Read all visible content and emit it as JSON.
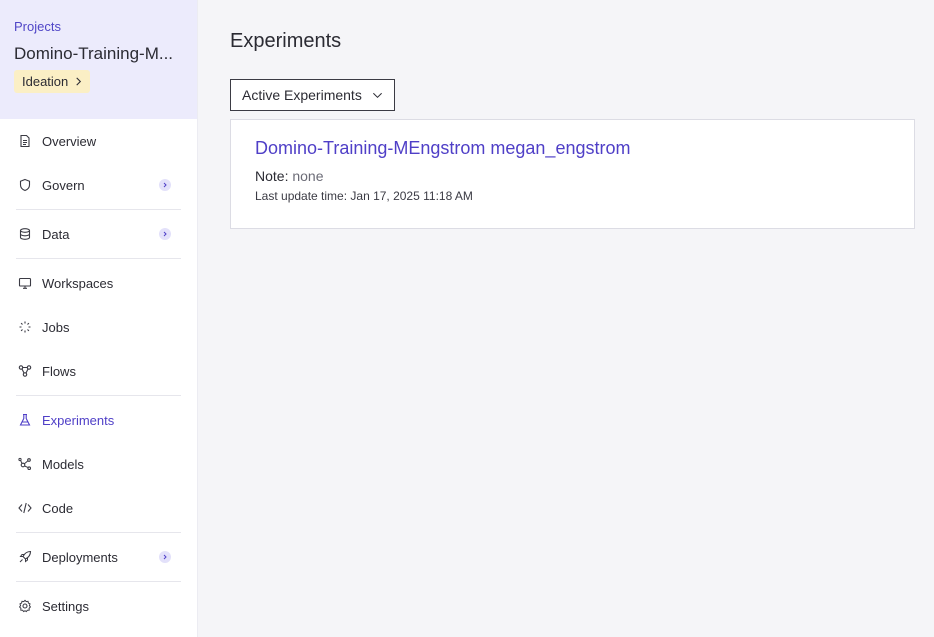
{
  "sidebar": {
    "projects_link": "Projects",
    "project_name": "Domino-Training-M...",
    "stage_label": "Ideation",
    "items": [
      {
        "label": "Overview",
        "icon": "document-icon",
        "expandable": false
      },
      {
        "label": "Govern",
        "icon": "shield-icon",
        "expandable": true
      },
      {
        "label": "Data",
        "icon": "database-icon",
        "expandable": true
      },
      {
        "label": "Workspaces",
        "icon": "monitor-icon",
        "expandable": false
      },
      {
        "label": "Jobs",
        "icon": "spinner-icon",
        "expandable": false
      },
      {
        "label": "Flows",
        "icon": "flow-icon",
        "expandable": false
      },
      {
        "label": "Experiments",
        "icon": "flask-icon",
        "expandable": false,
        "active": true
      },
      {
        "label": "Models",
        "icon": "model-icon",
        "expandable": false
      },
      {
        "label": "Code",
        "icon": "code-icon",
        "expandable": false
      },
      {
        "label": "Deployments",
        "icon": "rocket-icon",
        "expandable": true
      },
      {
        "label": "Settings",
        "icon": "gear-icon",
        "expandable": false
      }
    ]
  },
  "main": {
    "title": "Experiments",
    "filter_label": "Active Experiments",
    "experiment": {
      "title": "Domino-Training-MEngstrom megan_engstrom",
      "note_label": "Note:",
      "note_value": "none",
      "updated": "Last update time: Jan 17, 2025 11:18 AM"
    }
  },
  "colors": {
    "accent": "#4f3fc7",
    "project_header_bg": "#ecebfc",
    "stage_badge_bg": "#fbefc5",
    "page_bg": "#f5f5f8"
  }
}
